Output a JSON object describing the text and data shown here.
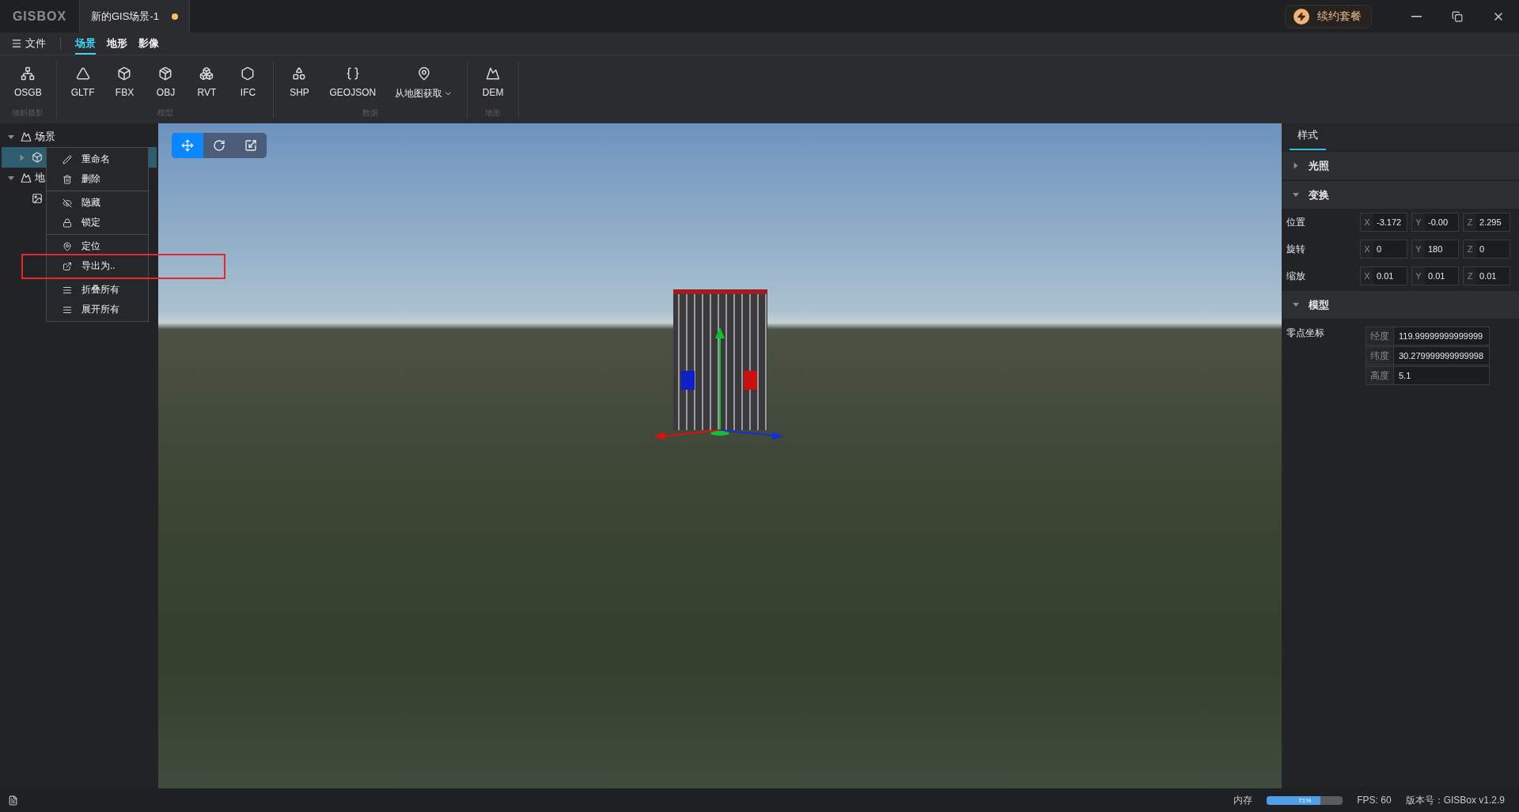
{
  "title_bar": {
    "logo": "GISBOX",
    "document_tab": {
      "label": "新的GIS场景-1",
      "modified": true
    },
    "renew_button": "续约套餐"
  },
  "menu_bar": {
    "file_menu": "文件",
    "tabs": [
      {
        "label": "场景",
        "selected": true
      },
      {
        "label": "地形",
        "selected": false
      },
      {
        "label": "影像",
        "selected": false
      }
    ]
  },
  "ribbon": {
    "groups": [
      {
        "label": "倾斜摄影",
        "items": [
          {
            "label": "OSGB"
          }
        ]
      },
      {
        "label": "模型",
        "items": [
          {
            "label": "GLTF"
          },
          {
            "label": "FBX"
          },
          {
            "label": "OBJ"
          },
          {
            "label": "RVT"
          },
          {
            "label": "IFC"
          }
        ]
      },
      {
        "label": "数据",
        "items": [
          {
            "label": "SHP"
          },
          {
            "label": "GEOJSON"
          },
          {
            "label": "从地图获取",
            "dropdown": true
          }
        ]
      },
      {
        "label": "地形",
        "items": [
          {
            "label": "DEM"
          }
        ]
      }
    ]
  },
  "scene_tree": [
    {
      "kind": "group",
      "label": "场景",
      "expanded": true,
      "selected": false,
      "children": [
        {
          "kind": "model",
          "expanded": false,
          "selected": true
        }
      ]
    },
    {
      "kind": "group",
      "label": "地",
      "expanded": true,
      "selected": false,
      "children": [
        {
          "kind": "imagery",
          "selected": false
        }
      ]
    }
  ],
  "context_menu": {
    "groups": [
      [
        {
          "label": "重命名",
          "highlighted": false
        },
        {
          "label": "删除",
          "highlighted": false
        }
      ],
      [
        {
          "label": "隐藏",
          "highlighted": false
        },
        {
          "label": "锁定",
          "highlighted": false
        }
      ],
      [
        {
          "label": "定位",
          "highlighted": false
        },
        {
          "label": "导出为..",
          "highlighted": true
        }
      ],
      [
        {
          "label": "折叠所有",
          "highlighted": false
        },
        {
          "label": "展开所有",
          "highlighted": false
        }
      ]
    ]
  },
  "viewport": {
    "tools": [
      {
        "selected": true
      },
      {
        "selected": false
      },
      {
        "selected": false
      }
    ]
  },
  "properties": {
    "tab": "样式",
    "sections": [
      {
        "title": "光照",
        "expanded": false
      },
      {
        "kind": "transform",
        "title": "变换",
        "expanded": true,
        "rows": [
          {
            "label": "位置",
            "values": [
              {
                "axis": "X",
                "value": "-3.172"
              },
              {
                "axis": "Y",
                "value": "-0.00"
              },
              {
                "axis": "Z",
                "value": "2.295"
              }
            ]
          },
          {
            "label": "旋转",
            "values": [
              {
                "axis": "X",
                "value": "0"
              },
              {
                "axis": "Y",
                "value": "180"
              },
              {
                "axis": "Z",
                "value": "0"
              }
            ]
          },
          {
            "label": "缩放",
            "values": [
              {
                "axis": "X",
                "value": "0.01"
              },
              {
                "axis": "Y",
                "value": "0.01"
              },
              {
                "axis": "Z",
                "value": "0.01"
              }
            ]
          }
        ]
      },
      {
        "kind": "model",
        "title": "模型",
        "expanded": true,
        "label": "零点坐标",
        "fields": [
          {
            "label": "经度",
            "value": "119.99999999999999"
          },
          {
            "label": "纬度",
            "value": "30.279999999999998"
          },
          {
            "label": "高度",
            "value": "5.1"
          }
        ]
      }
    ]
  },
  "status_bar": {
    "memory_label": "内存",
    "memory": {
      "level": 0.71,
      "reading": "71%"
    },
    "fps": "FPS: 60",
    "version": "版本号：GISBox v1.2.9"
  }
}
